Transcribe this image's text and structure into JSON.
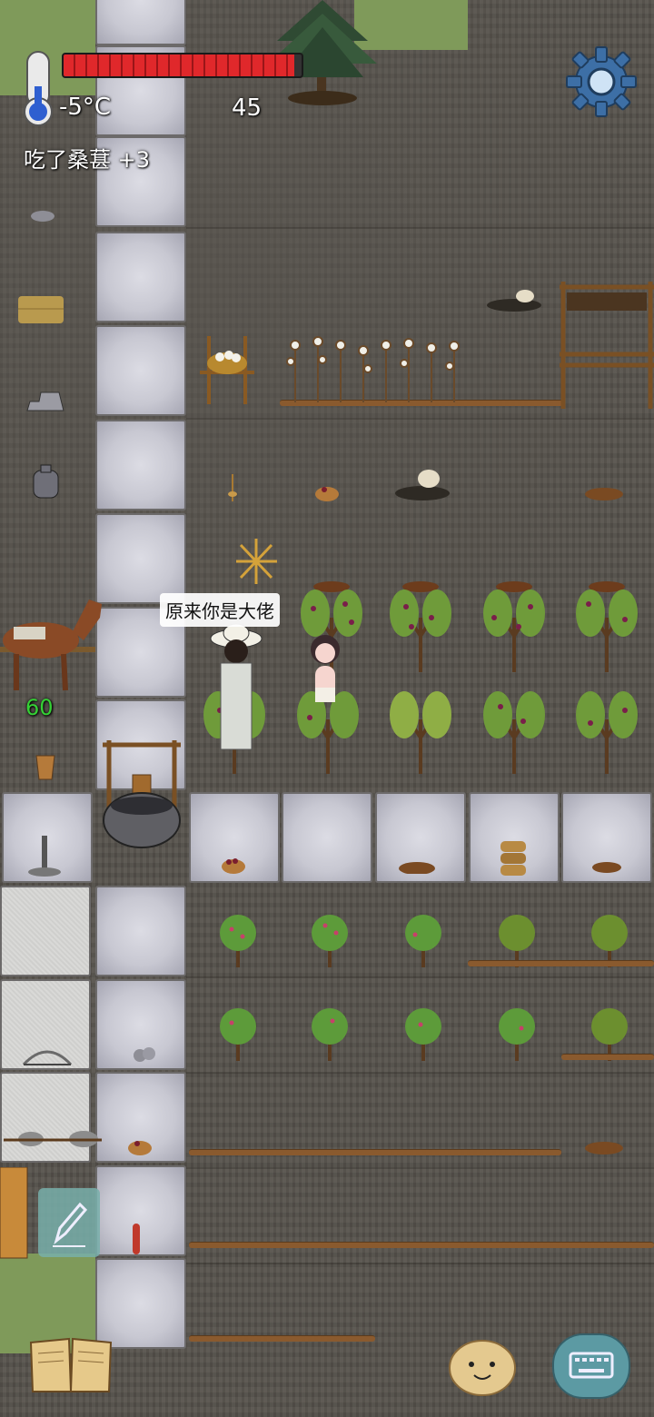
{
  "hud": {
    "temperature": "-5°C",
    "health_fraction": 0.97,
    "age": "45",
    "status_message": "吃了桑葚 +3",
    "horse_counter": "60"
  },
  "speech_bubble": {
    "text": "原来你是大佬"
  },
  "colors": {
    "health_bar": "#e0282b",
    "horse_counter": "#35d135",
    "settings_gear": "#3d6fa6",
    "keyboard_button": "#5c9aa3"
  },
  "icons": {
    "settings": "gear-icon",
    "edit": "pencil-icon",
    "recipe_book": "book-icon",
    "emote": "potato-face-icon",
    "keyboard": "keyboard-icon",
    "thermometer": "thermometer-icon"
  }
}
